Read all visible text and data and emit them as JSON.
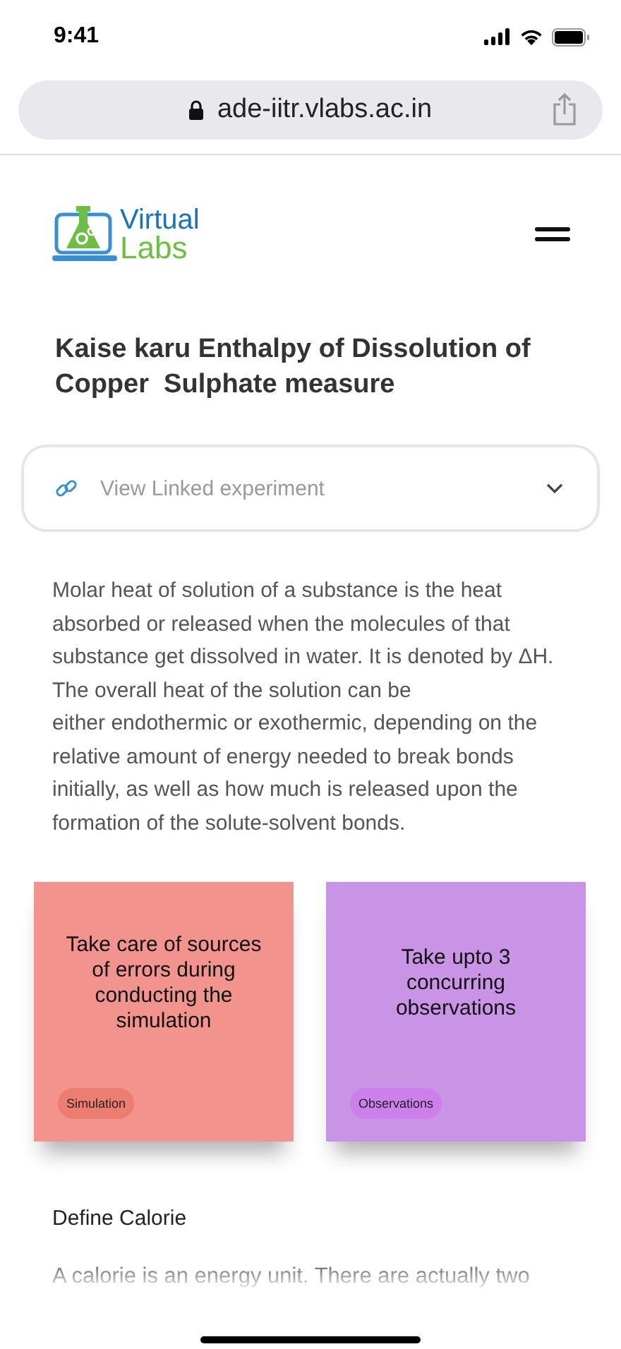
{
  "status_bar": {
    "time": "9:41"
  },
  "browser": {
    "url": "ade-iitr.vlabs.ac.in"
  },
  "header": {
    "logo": {
      "line1": "Virtual",
      "line2": "Labs"
    }
  },
  "title": "Kaise karu Enthalpy of Dissolution of Copper  Sulphate measure",
  "linked_experiment": {
    "label": "View Linked experiment",
    "expanded": false
  },
  "intro": "Molar heat of solution of a substance is the heat absorbed or released when the molecules of that substance get dissolved in water. It is denoted by ΔH. The overall heat of the solution can be\neither endothermic or exothermic, depending on the relative amount of energy needed to break bonds initially, as well as how much is released upon the formation of the solute-solvent bonds.",
  "cards": [
    {
      "text": "Take care of sources of errors during conducting the simulation",
      "tag": "Simulation",
      "color": "#f2948d"
    },
    {
      "text": "Take upto 3 concurring observations",
      "tag": "Observations",
      "color": "#c994e6"
    }
  ],
  "section": {
    "heading": "Define Calorie",
    "text": "A calorie is an energy unit. There are actually two"
  }
}
